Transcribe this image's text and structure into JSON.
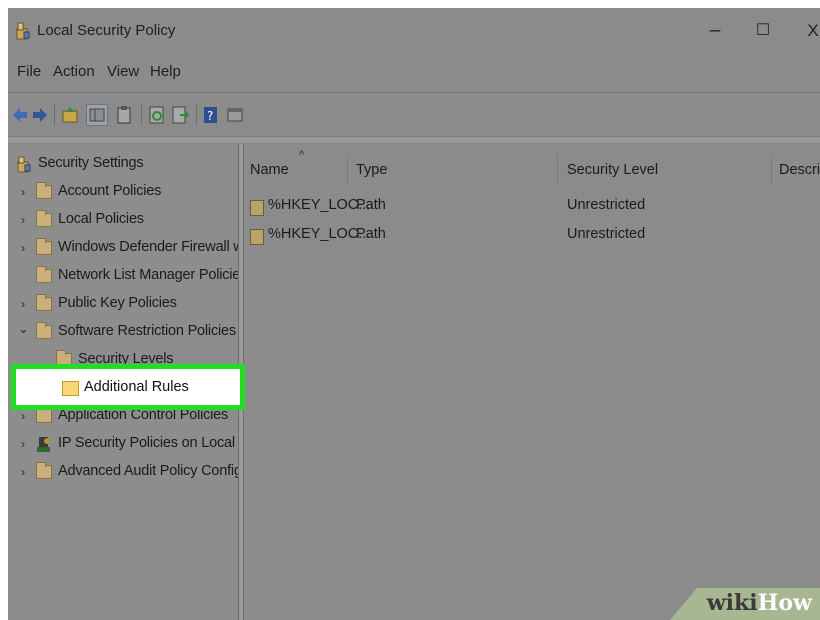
{
  "window": {
    "title": "Local Security Policy",
    "controls": {
      "minimize": "–",
      "maximize": "☐",
      "close": "X"
    }
  },
  "menu": {
    "items": [
      "File",
      "Action",
      "View",
      "Help"
    ]
  },
  "tree": {
    "root": "Security Settings",
    "items": [
      {
        "label": "Account Policies",
        "expander": "›"
      },
      {
        "label": "Local Policies",
        "expander": "›"
      },
      {
        "label": "Windows Defender Firewall with",
        "expander": "›"
      },
      {
        "label": "Network List Manager Policies",
        "expander": ""
      },
      {
        "label": "Public Key Policies",
        "expander": "›"
      },
      {
        "label": "Software Restriction Policies",
        "expander": "⌄"
      },
      {
        "label": "Security Levels",
        "expander": ""
      },
      {
        "label": "Additional Rules",
        "expander": ""
      },
      {
        "label": "Application Control Policies",
        "expander": "›"
      },
      {
        "label": "IP Security Policies on Local Cor",
        "expander": "›"
      },
      {
        "label": "Advanced Audit Policy Configu",
        "expander": "›"
      }
    ],
    "selected": "Additional Rules"
  },
  "list": {
    "columns": [
      "Name",
      "Type",
      "Security Level",
      "Descrip"
    ],
    "rows": [
      {
        "name": "%HKEY_LOC...",
        "type": "Path",
        "level": "Unrestricted"
      },
      {
        "name": "%HKEY_LOC...",
        "type": "Path",
        "level": "Unrestricted"
      }
    ]
  },
  "watermark": {
    "part1": "wiki",
    "part2": "How"
  },
  "colors": {
    "highlight": "#22dd22",
    "background": "#8b8b8b"
  }
}
